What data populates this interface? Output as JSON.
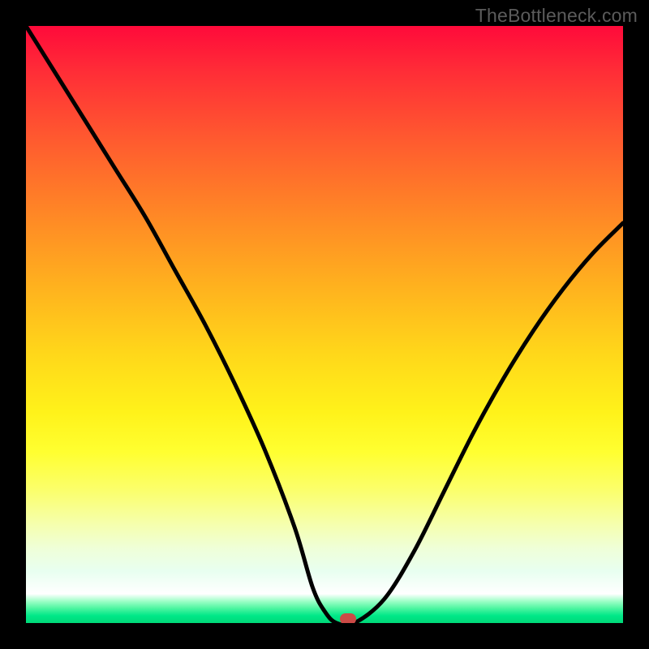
{
  "watermark": "TheBottleneck.com",
  "colors": {
    "frame": "#000000",
    "curve": "#000000",
    "marker": "#cc4a46"
  },
  "chart_data": {
    "type": "line",
    "title": "",
    "xlabel": "",
    "ylabel": "",
    "xlim": [
      0,
      100
    ],
    "ylim": [
      0,
      100
    ],
    "x": [
      0,
      5,
      10,
      15,
      20,
      25,
      30,
      35,
      40,
      45,
      48,
      50,
      52,
      55,
      60,
      65,
      70,
      75,
      80,
      85,
      90,
      95,
      100
    ],
    "values": [
      100,
      92,
      84,
      76,
      68,
      59,
      50,
      40,
      29,
      16,
      6,
      2,
      0,
      0,
      4,
      12,
      22,
      32,
      41,
      49,
      56,
      62,
      67
    ],
    "flat_segment": {
      "x_start": 48,
      "x_end": 55,
      "y": 0
    },
    "marker": {
      "x": 54,
      "y": 0
    },
    "grid": false,
    "legend": false
  }
}
